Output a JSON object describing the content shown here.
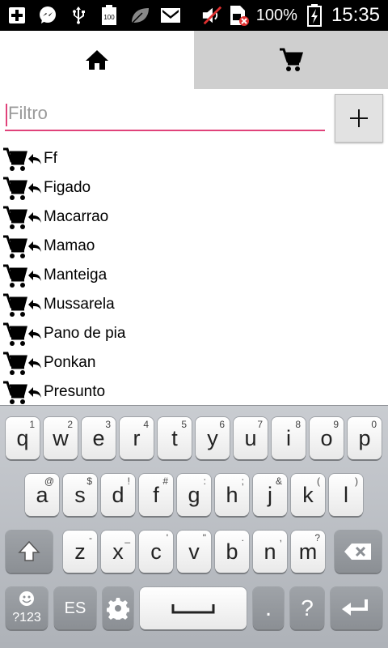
{
  "status_bar": {
    "icons": [
      "plus-icon",
      "messenger-icon",
      "usb-icon",
      "battery-100-icon",
      "leaf-icon",
      "mail-icon",
      "mute-icon",
      "sim-error-icon",
      "charging-icon"
    ],
    "battery_percent": "100%",
    "time": "15:35"
  },
  "tabs": [
    {
      "icon": "home-icon",
      "active": true
    },
    {
      "icon": "cart-icon",
      "active": false
    }
  ],
  "filter": {
    "placeholder": "Filtro",
    "value": ""
  },
  "add_button_label": "+",
  "items": [
    {
      "label": "Ff"
    },
    {
      "label": "Figado"
    },
    {
      "label": "Macarrao"
    },
    {
      "label": "Mamao"
    },
    {
      "label": "Manteiga"
    },
    {
      "label": "Mussarela"
    },
    {
      "label": "Pano de pia"
    },
    {
      "label": "Ponkan"
    },
    {
      "label": "Presunto"
    }
  ],
  "keyboard": {
    "row1": [
      {
        "k": "q",
        "h": "1"
      },
      {
        "k": "w",
        "h": "2"
      },
      {
        "k": "e",
        "h": "3"
      },
      {
        "k": "r",
        "h": "4"
      },
      {
        "k": "t",
        "h": "5"
      },
      {
        "k": "y",
        "h": "6"
      },
      {
        "k": "u",
        "h": "7"
      },
      {
        "k": "i",
        "h": "8"
      },
      {
        "k": "o",
        "h": "9"
      },
      {
        "k": "p",
        "h": "0"
      }
    ],
    "row2": [
      {
        "k": "a",
        "h": "@"
      },
      {
        "k": "s",
        "h": "$"
      },
      {
        "k": "d",
        "h": "!"
      },
      {
        "k": "f",
        "h": "#"
      },
      {
        "k": "g",
        "h": ":"
      },
      {
        "k": "h",
        "h": ";"
      },
      {
        "k": "j",
        "h": "&"
      },
      {
        "k": "k",
        "h": "("
      },
      {
        "k": "l",
        "h": ")"
      }
    ],
    "row3": [
      {
        "k": "z",
        "h": "-"
      },
      {
        "k": "x",
        "h": "_"
      },
      {
        "k": "c",
        "h": "'"
      },
      {
        "k": "v",
        "h": "\""
      },
      {
        "k": "b",
        "h": "."
      },
      {
        "k": "n",
        "h": ","
      },
      {
        "k": "m",
        "h": "?"
      }
    ],
    "mode_label": "?123",
    "lang_label": "ES",
    "period": ".",
    "question": "?"
  }
}
